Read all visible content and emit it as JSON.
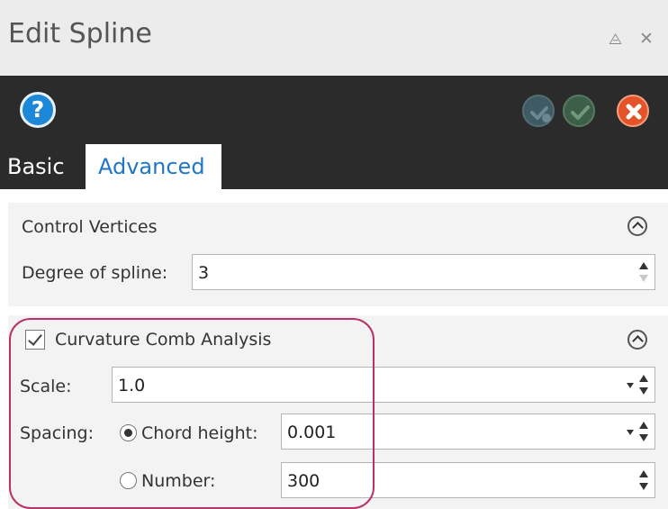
{
  "window": {
    "title": "Edit Spline",
    "pin_icon": "pin-icon",
    "close_icon": "close-icon"
  },
  "toolbar": {
    "help_label": "?",
    "colors": {
      "help": "#1e88d8",
      "cancel": "#e4532a",
      "background": "#2b2b2b"
    }
  },
  "tabs": [
    {
      "label": "Basic",
      "active": false
    },
    {
      "label": "Advanced",
      "active": true,
      "color": "#1f77c6"
    }
  ],
  "control_vertices": {
    "heading": "Control Vertices",
    "degree_label": "Degree of spline:",
    "degree_value": "3"
  },
  "curvature": {
    "heading": "Curvature Comb Analysis",
    "enabled": true,
    "scale_label": "Scale:",
    "scale_value": "1.0",
    "spacing_label": "Spacing:",
    "chord_label": "Chord height:",
    "chord_value": "0.001",
    "chord_selected": true,
    "number_label": "Number:",
    "number_value": "300",
    "number_selected": false,
    "highlight_color": "#b8336a"
  }
}
